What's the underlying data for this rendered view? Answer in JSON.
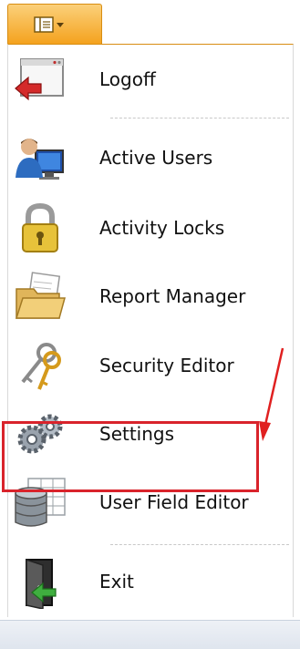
{
  "menu": {
    "items": [
      {
        "label": "Logoff",
        "icon": "logoff-icon"
      },
      {
        "label": "Active Users",
        "icon": "active-users-icon"
      },
      {
        "label": "Activity Locks",
        "icon": "padlock-icon"
      },
      {
        "label": "Report Manager",
        "icon": "folder-icon"
      },
      {
        "label": "Security Editor",
        "icon": "keys-icon"
      },
      {
        "label": "Settings",
        "icon": "gears-icon"
      },
      {
        "label": "User Field Editor",
        "icon": "database-grid-icon"
      },
      {
        "label": "Exit",
        "icon": "exit-door-icon"
      }
    ]
  },
  "colors": {
    "tab_orange": "#f4a21e",
    "highlight_red": "#d9232b",
    "arrow_red": "#e02020"
  }
}
